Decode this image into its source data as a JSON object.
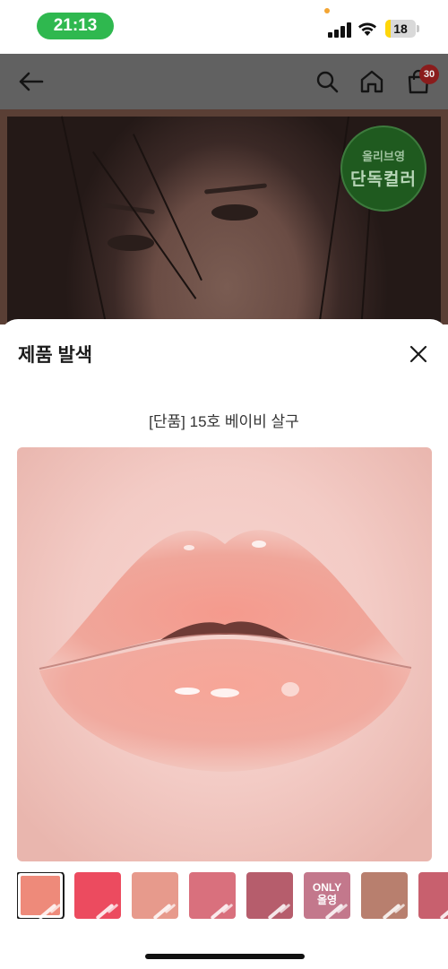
{
  "status_bar": {
    "time": "21:13",
    "battery_level": "18",
    "battery_fill_percent": 18
  },
  "header": {
    "back_icon": "arrow-left-icon",
    "search_icon": "search-icon",
    "home_icon": "home-icon",
    "cart_icon": "shopping-bag-icon",
    "cart_count": "30"
  },
  "product_photo": {
    "badge_line1": "올리브영",
    "badge_line2": "단독컬러"
  },
  "sheet": {
    "title": "제품 발색",
    "close_icon": "close-icon",
    "shade_name": "[단품] 15호 베이비 살구",
    "thumbnails": [
      {
        "color": "#ee8a7a",
        "selected": true
      },
      {
        "color": "#ec4b5f",
        "selected": false
      },
      {
        "color": "#e79a8c",
        "selected": false
      },
      {
        "color": "#d9707d",
        "selected": false
      },
      {
        "color": "#b65d6c",
        "selected": false
      },
      {
        "color": "#c3788c",
        "selected": false,
        "label_line1": "ONLY",
        "label_line2": "올영"
      },
      {
        "color": "#b87f6e",
        "selected": false
      },
      {
        "color": "#c8606e",
        "selected": false
      }
    ]
  },
  "colors": {
    "status_time_pill": "#2fb84f",
    "dim_overlay": "#616161",
    "badge_green": "#1f5a1f"
  }
}
